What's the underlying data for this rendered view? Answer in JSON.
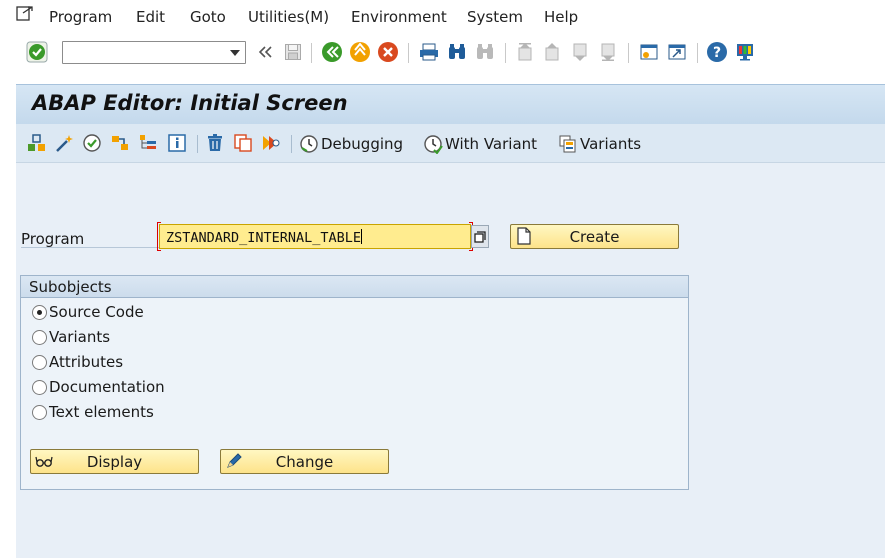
{
  "menu": {
    "items": [
      "Program",
      "Edit",
      "Goto",
      "Utilities(M)",
      "Environment",
      "System",
      "Help"
    ]
  },
  "toolbar": {
    "command_field_value": "",
    "icons": [
      "enter-icon",
      "back-double-icon",
      "save-icon",
      "back-icon",
      "exit-icon",
      "cancel-icon",
      "print-icon",
      "find-icon",
      "find-next-icon",
      "first-page-icon",
      "previous-page-icon",
      "next-page-icon",
      "last-page-icon",
      "create-session-icon",
      "shortcut-icon",
      "help-icon",
      "customize-layout-icon"
    ]
  },
  "title": {
    "text": "ABAP Editor: Initial Screen"
  },
  "app_toolbar": {
    "icons": [
      "other-object-icon",
      "activate-wand-icon",
      "check-icon",
      "where-used-icon",
      "object-list-icon",
      "info-icon",
      "delete-icon",
      "copy-icon",
      "rename-icon"
    ],
    "debugging_label": "Debugging",
    "with_variant_label": "With Variant",
    "variants_label": "Variants"
  },
  "form": {
    "program_label": "Program",
    "program_value": "ZSTANDARD_INTERNAL_TABLE",
    "create_label": "Create"
  },
  "subobjects": {
    "title": "Subobjects",
    "options": [
      {
        "label": "Source Code",
        "selected": true
      },
      {
        "label": "Variants",
        "selected": false
      },
      {
        "label": "Attributes",
        "selected": false
      },
      {
        "label": "Documentation",
        "selected": false
      },
      {
        "label": "Text elements",
        "selected": false
      }
    ],
    "display_label": "Display",
    "change_label": "Change"
  },
  "colors": {
    "accent_green": "#3a9a2a",
    "title_bar": "#c4d9ec",
    "main_bg": "#e8eff7",
    "input_yellow": "#ffec8f",
    "button_yellow": "#fde38a"
  }
}
